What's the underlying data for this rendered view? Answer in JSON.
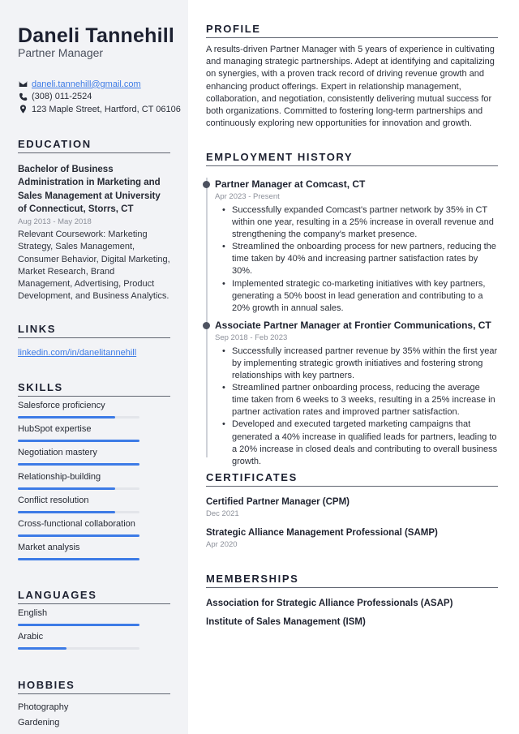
{
  "header": {
    "name": "Daneli Tannehill",
    "title": "Partner Manager"
  },
  "contact": {
    "email": "daneli.tannehill@gmail.com",
    "phone": "(308) 011-2524",
    "address": "123 Maple Street, Hartford, CT 06106",
    "icons": [
      "envelope-icon",
      "phone-icon",
      "map-pin-icon"
    ]
  },
  "education": {
    "heading": "EDUCATION",
    "degree": "Bachelor of Business Administration in Marketing and Sales Management at University of Connecticut, Storrs, CT",
    "date": "Aug 2013 - May 2018",
    "description": "Relevant Coursework: Marketing Strategy, Sales Management, Consumer Behavior, Digital Marketing, Market Research, Brand Management, Advertising, Product Development, and Business Analytics."
  },
  "links": {
    "heading": "LINKS",
    "items": [
      {
        "label": "linkedin.com/in/danelitannehill"
      }
    ]
  },
  "skills": {
    "heading": "SKILLS",
    "items": [
      {
        "label": "Salesforce proficiency",
        "level": 0.8
      },
      {
        "label": "HubSpot expertise",
        "level": 1.0
      },
      {
        "label": "Negotiation mastery",
        "level": 1.0
      },
      {
        "label": "Relationship-building",
        "level": 0.8
      },
      {
        "label": "Conflict resolution",
        "level": 0.8
      },
      {
        "label": "Cross-functional collaboration",
        "level": 1.0
      },
      {
        "label": "Market analysis",
        "level": 1.0
      }
    ]
  },
  "languages": {
    "heading": "LANGUAGES",
    "items": [
      {
        "label": "English",
        "level": 1.0
      },
      {
        "label": "Arabic",
        "level": 0.4
      }
    ]
  },
  "hobbies": {
    "heading": "HOBBIES",
    "items": [
      "Photography",
      "Gardening"
    ]
  },
  "profile": {
    "heading": "PROFILE",
    "text": "A results-driven Partner Manager with 5 years of experience in cultivating and managing strategic partnerships. Adept at identifying and capitalizing on synergies, with a proven track record of driving revenue growth and enhancing product offerings. Expert in relationship management, collaboration, and negotiation, consistently delivering mutual success for both organizations. Committed to fostering long-term partnerships and continuously exploring new opportunities for innovation and growth."
  },
  "employment": {
    "heading": "EMPLOYMENT HISTORY",
    "jobs": [
      {
        "title": "Partner Manager at Comcast, CT",
        "date": "Apr 2023 - Present",
        "bullets": [
          "Successfully expanded Comcast's partner network by 35% in CT within one year, resulting in a 25% increase in overall revenue and strengthening the company's market presence.",
          "Streamlined the onboarding process for new partners, reducing the time taken by 40% and increasing partner satisfaction rates by 30%.",
          "Implemented strategic co-marketing initiatives with key partners, generating a 50% boost in lead generation and contributing to a 20% growth in annual sales."
        ]
      },
      {
        "title": "Associate Partner Manager at Frontier Communications, CT",
        "date": "Sep 2018 - Feb 2023",
        "bullets": [
          "Successfully increased partner revenue by 35% within the first year by implementing strategic growth initiatives and fostering strong relationships with key partners.",
          "Streamlined partner onboarding process, reducing the average time taken from 6 weeks to 3 weeks, resulting in a 25% increase in partner activation rates and improved partner satisfaction.",
          "Developed and executed targeted marketing campaigns that generated a 40% increase in qualified leads for partners, leading to a 20% increase in closed deals and contributing to overall business growth."
        ]
      }
    ]
  },
  "certificates": {
    "heading": "CERTIFICATES",
    "items": [
      {
        "title": "Certified Partner Manager (CPM)",
        "date": "Dec 2021"
      },
      {
        "title": "Strategic Alliance Management Professional (SAMP)",
        "date": "Apr 2020"
      }
    ]
  },
  "memberships": {
    "heading": "MEMBERSHIPS",
    "items": [
      "Association for Strategic Alliance Professionals (ASAP)",
      "Institute of Sales Management (ISM)"
    ]
  },
  "colors": {
    "accent": "#3d7be6",
    "sidebar_bg": "#f2f3f6",
    "text": "#1f2330",
    "muted": "#8c909a"
  }
}
